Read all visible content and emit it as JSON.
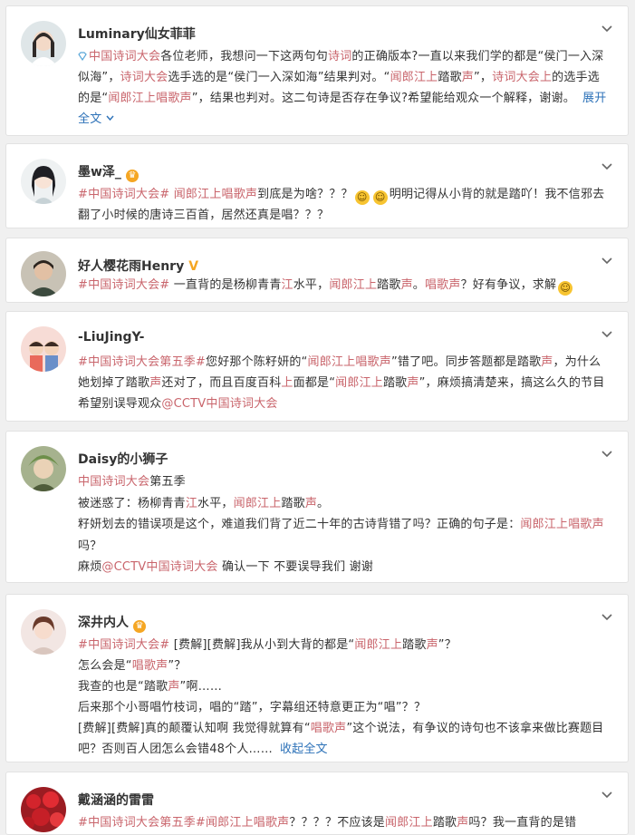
{
  "posts": [
    {
      "user": "Luminary仙女菲菲",
      "text": [
        {
          "t": "中国诗词大会",
          "c": "tag"
        },
        {
          "t": "各位老师，我想问一下这两句句"
        },
        {
          "t": "诗词",
          "c": "tag"
        },
        {
          "t": "的正确版本?一直以来我们学的都是“侯门一入深似海”，"
        },
        {
          "t": "诗词大会",
          "c": "tag"
        },
        {
          "t": "选手选的是“侯门一入深如海”结果判对。“"
        },
        {
          "t": "闻郎江上",
          "c": "tag"
        },
        {
          "t": "踏歌"
        },
        {
          "t": "声",
          "c": "tag"
        },
        {
          "t": "”，"
        },
        {
          "t": "诗词大会上",
          "c": "tag"
        },
        {
          "t": "的选手选的是“"
        },
        {
          "t": "闻郎江上唱歌声",
          "c": "tag"
        },
        {
          "t": "”，结果也判对。这二句诗是否存在争议?希望能给观众一个解释，谢谢。"
        }
      ],
      "more": "展开全文"
    },
    {
      "user": "墨w泽_",
      "text": [
        {
          "t": "#中国诗词大会#",
          "c": "tag"
        },
        {
          "t": " "
        },
        {
          "t": "闻郎江上唱歌声",
          "c": "tag"
        },
        {
          "t": "到底是为啥？？？"
        },
        {
          "emoji": "😀"
        },
        {
          "emoji": "😀"
        },
        {
          "t": "明明记得从小背的就是踏吖！我不信邪去翻了小时候的唐诗三百首，居然还真是唱？？？"
        }
      ]
    },
    {
      "user": "好人樱花雨Henry",
      "text": [
        {
          "t": "#中国诗词大会#",
          "c": "tag"
        },
        {
          "t": " 一直背的是杨柳青青"
        },
        {
          "t": "江",
          "c": "tag"
        },
        {
          "t": "水平，"
        },
        {
          "t": "闻郎江上",
          "c": "tag"
        },
        {
          "t": "踏歌"
        },
        {
          "t": "声",
          "c": "tag"
        },
        {
          "t": "。"
        },
        {
          "t": "唱歌声",
          "c": "tag"
        },
        {
          "t": "？好有争议，求解"
        },
        {
          "emoji": "😀"
        }
      ]
    },
    {
      "user": "-LiuJingY-",
      "text": [
        {
          "t": "#中国诗词大会第五季#",
          "c": "tag"
        },
        {
          "t": "您好那个陈籽妍的“"
        },
        {
          "t": "闻郎江上唱歌声",
          "c": "tag"
        },
        {
          "t": "”错了吧。同步答题都是踏歌"
        },
        {
          "t": "声",
          "c": "tag"
        },
        {
          "t": "，为什么她划掉了踏歌"
        },
        {
          "t": "声",
          "c": "tag"
        },
        {
          "t": "还对了，而且百度百科"
        },
        {
          "t": "上",
          "c": "tag"
        },
        {
          "t": "面都是“"
        },
        {
          "t": "闻郎江上",
          "c": "tag"
        },
        {
          "t": "踏歌"
        },
        {
          "t": "声",
          "c": "tag"
        },
        {
          "t": "”，麻烦搞清楚来，搞这么久的节目希望别误导观众"
        },
        {
          "t": "@CCTV中国诗词大会",
          "c": "tag"
        }
      ]
    },
    {
      "user": "Daisy的小狮子",
      "paras": [
        [
          {
            "t": "中国诗词大会",
            "c": "tag"
          },
          {
            "t": "第五季"
          }
        ],
        [
          {
            "t": "被迷惑了：杨柳青青"
          },
          {
            "t": "江",
            "c": "tag"
          },
          {
            "t": "水平，"
          },
          {
            "t": "闻郎江上",
            "c": "tag"
          },
          {
            "t": "踏歌"
          },
          {
            "t": "声",
            "c": "tag"
          },
          {
            "t": "。"
          }
        ],
        [
          {
            "t": "籽妍划去的错误项是这个，难道我们背了近二十年的古诗背错了吗？正确的句子是："
          },
          {
            "t": "闻郎江上唱歌声",
            "c": "tag"
          },
          {
            "t": "吗？"
          }
        ],
        [
          {
            "t": "麻烦"
          },
          {
            "t": "@CCTV中国诗词大会",
            "c": "tag"
          },
          {
            "t": " 确认一下 不要误导我们 谢谢"
          }
        ]
      ]
    },
    {
      "user": "深井内人",
      "paras": [
        [
          {
            "t": "#中国诗词大会#",
            "c": "tag"
          },
          {
            "t": " [费解][费解]我从小到大背的都是“"
          },
          {
            "t": "闻郎江上",
            "c": "tag"
          },
          {
            "t": "踏歌"
          },
          {
            "t": "声",
            "c": "tag"
          },
          {
            "t": "”？"
          }
        ],
        [
          {
            "t": "怎么会是“"
          },
          {
            "t": "唱歌声",
            "c": "tag"
          },
          {
            "t": "”？"
          }
        ],
        [
          {
            "t": "我查的也是“踏歌"
          },
          {
            "t": "声",
            "c": "tag"
          },
          {
            "t": "”啊……"
          }
        ],
        [
          {
            "t": "后来那个小哥唱竹枝词，唱的“踏”，字幕组还特意更正为“唱”？？"
          }
        ],
        [
          {
            "t": "[费解][费解]真的颠覆认知啊 我觉得就算有“"
          },
          {
            "t": "唱歌声",
            "c": "tag"
          },
          {
            "t": "”这个说法，有争议的诗句也不该拿来做比赛题目吧？否则百人团怎么会错48个人……"
          },
          {
            "t": "收起全文",
            "c": "more"
          }
        ]
      ]
    },
    {
      "user": "戴涵涵的雷雷",
      "text": [
        {
          "t": "#中国诗词大会第五季#闻郎江上唱歌声",
          "c": "tag"
        },
        {
          "t": "？？？？不应该是"
        },
        {
          "t": "闻郎江上",
          "c": "tag"
        },
        {
          "t": "踏歌"
        },
        {
          "t": "声",
          "c": "tag"
        },
        {
          "t": "吗？我一直背的是错"
        }
      ]
    }
  ]
}
